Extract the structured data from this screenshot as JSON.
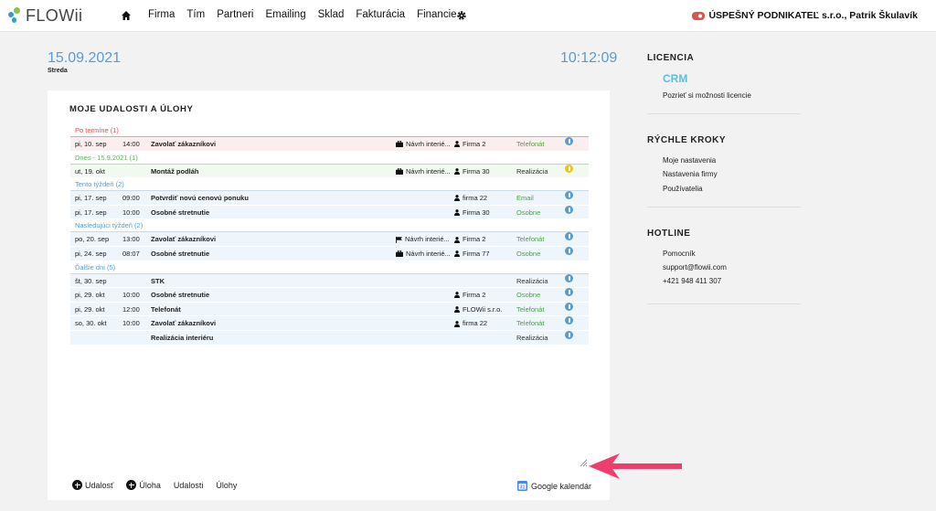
{
  "brand": {
    "name": "FLOWii"
  },
  "nav": {
    "items": [
      "Firma",
      "Tím",
      "Partneri",
      "Emailing",
      "Sklad",
      "Fakturácia",
      "Financie"
    ]
  },
  "company": {
    "label": "ÚSPEŠNÝ PODNIKATEĽ s.r.o., Patrik Škulavík"
  },
  "header": {
    "date": "15.09.2021",
    "weekday": "Streda",
    "time": "10:12:09"
  },
  "panel": {
    "title": "MOJE UDALOSTI A ÚLOHY",
    "groups": [
      {
        "label": "Po termíne (1)",
        "color": "#d9534f",
        "rows": [
          {
            "date": "pi, 10. sep",
            "time": "14:00",
            "title": "Zavolať zákazníkovi",
            "project": "Návrh interié...",
            "project_icon": "briefcase-icon",
            "client": "Firma 2",
            "type": "Telefonát",
            "status_color": "#5b9ccc"
          }
        ]
      },
      {
        "label": "Dnes - 15.9.2021 (1)",
        "color": "#5cb85c",
        "rows": [
          {
            "date": "ut, 19. okt",
            "time": "",
            "title": "Montáž podláh",
            "project": "Návrh interié...",
            "project_icon": "briefcase-icon",
            "client": "Firma 30",
            "type": "Realizácia",
            "status_color": "#f0c419"
          }
        ]
      },
      {
        "label": "Tento týždeň (2)",
        "color": "#5b9ccc",
        "rows": [
          {
            "date": "pi, 17. sep",
            "time": "09:00",
            "title": "Potvrdiť novú cenovú ponuku",
            "project": "",
            "client": "firma 22",
            "type": "Email",
            "status_color": "#5b9ccc"
          },
          {
            "date": "pi, 17. sep",
            "time": "10:00",
            "title": "Osobné stretnutie",
            "project": "",
            "client": "Firma 30",
            "type": "Osobne",
            "status_color": "#5b9ccc"
          }
        ]
      },
      {
        "label": "Nasledujúci týždeň (2)",
        "color": "#5b9ccc",
        "rows": [
          {
            "date": "po, 20. sep",
            "time": "13:00",
            "title": "Zavolať zákazníkovi",
            "project": "Návrh interié...",
            "project_icon": "flag-icon",
            "client": "Firma 2",
            "type": "Telefonát",
            "status_color": "#5b9ccc"
          },
          {
            "date": "pi, 24. sep",
            "time": "08:07",
            "title": "Osobné stretnutie",
            "project": "Návrh interié...",
            "project_icon": "briefcase-icon",
            "client": "Firma 77",
            "type": "Osobne",
            "status_color": "#5b9ccc"
          }
        ]
      },
      {
        "label": "Ďalšie dni (5)",
        "color": "#5b9ccc",
        "rows": [
          {
            "date": "št, 30. sep",
            "time": "",
            "title": "STK",
            "project": "",
            "client": "",
            "type": "Realizácia",
            "status_color": "#5b9ccc"
          },
          {
            "date": "pi, 29. okt",
            "time": "10:00",
            "title": "Osobné stretnutie",
            "project": "",
            "client": "Firma 2",
            "type": "Osobne",
            "status_color": "#5b9ccc"
          },
          {
            "date": "pi, 29. okt",
            "time": "12:00",
            "title": "Telefonát",
            "project": "",
            "client": "FLOWii s.r.o.",
            "type": "Telefonát",
            "status_color": "#5b9ccc"
          },
          {
            "date": "so, 30. okt",
            "time": "10:00",
            "title": "Zavolať zákazníkovi",
            "project": "",
            "client": "firma 22",
            "type": "Telefonát",
            "status_color": "#5b9ccc"
          },
          {
            "date": "",
            "time": "",
            "title": "Realizácia interiéru",
            "project": "",
            "client": "",
            "type": "Realizácia",
            "status_color": "#5b9ccc"
          }
        ]
      }
    ],
    "footer": {
      "add_event": "Udalosť",
      "add_task": "Úloha",
      "events": "Udalosti",
      "tasks": "Úlohy",
      "google_calendar": "Google kalendár"
    }
  },
  "sidebar": {
    "license": {
      "title": "LICENCIA",
      "plan": "CRM",
      "link": "Pozrieť si možnosti licencie"
    },
    "quick": {
      "title": "RÝCHLE KROKY",
      "items": [
        "Moje nastavenia",
        "Nastavenia firmy",
        "Používatelia"
      ]
    },
    "hotline": {
      "title": "HOTLINE",
      "items": [
        "Pomocník",
        "support@flowii.com",
        "+421 948 411 307"
      ]
    }
  },
  "colors": {
    "accent": "#5b9ccc",
    "overdue": "#d9534f",
    "today": "#5cb85c",
    "arrow": "#ef3d6e"
  }
}
